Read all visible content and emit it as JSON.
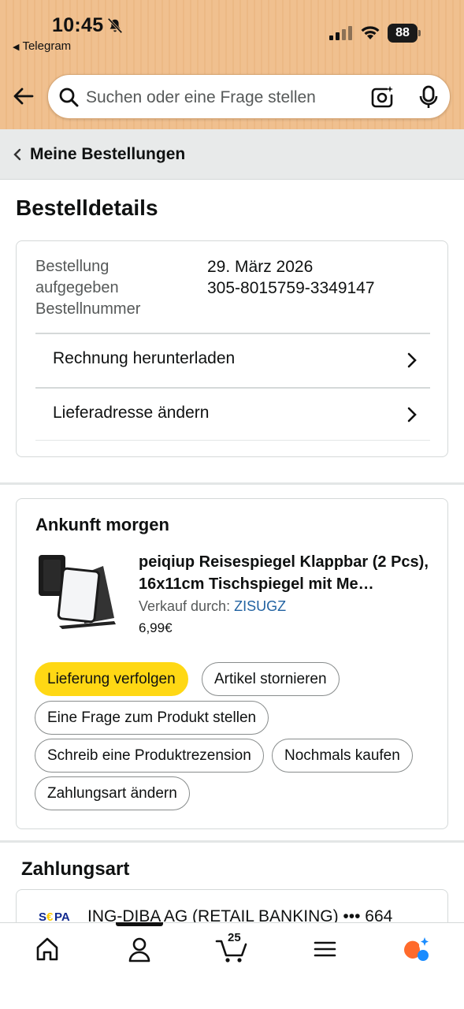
{
  "status_bar": {
    "time": "10:45",
    "back_app": "Telegram",
    "battery": "88"
  },
  "search": {
    "placeholder": "Suchen oder eine Frage stellen"
  },
  "breadcrumb": {
    "label": "Meine Bestellungen"
  },
  "page_title": "Bestelldetails",
  "order": {
    "labels": [
      "Bestellung",
      "aufgegeben",
      "Bestellnummer"
    ],
    "date": "29. März 2026",
    "number": "305-8015759-3349147",
    "actions": [
      "Rechnung herunterladen",
      "Lieferadresse ändern"
    ]
  },
  "shipment": {
    "title": "Ankunft morgen",
    "product_title": "peiqiup Reisespiegel Klappbar (2 Pcs), 16x11cm Tischspiegel mit Me…",
    "seller_prefix": "Verkauf durch:",
    "seller_name": "ZISUGZ",
    "price": "6,99€",
    "buttons": {
      "track": "Lieferung verfolgen",
      "cancel": "Artikel stornieren",
      "question": "Eine Frage zum Produkt stellen",
      "review": "Schreib eine Produktrezension",
      "buy_again": "Nochmals kaufen",
      "change_payment": "Zahlungsart ändern"
    }
  },
  "payment": {
    "title": "Zahlungsart",
    "bank": "ING-DIBA AG (RETAIL BANKING) ••• 664",
    "logo_text": "SEPA"
  },
  "tabbar": {
    "cart_count": "25",
    "tabs": [
      "home-icon",
      "account-icon",
      "cart-icon",
      "menu-icon",
      "rufus-icon"
    ]
  },
  "colors": {
    "header_bg": "#f0c08f",
    "primary_button": "#ffd814",
    "link": "#2162a1"
  }
}
